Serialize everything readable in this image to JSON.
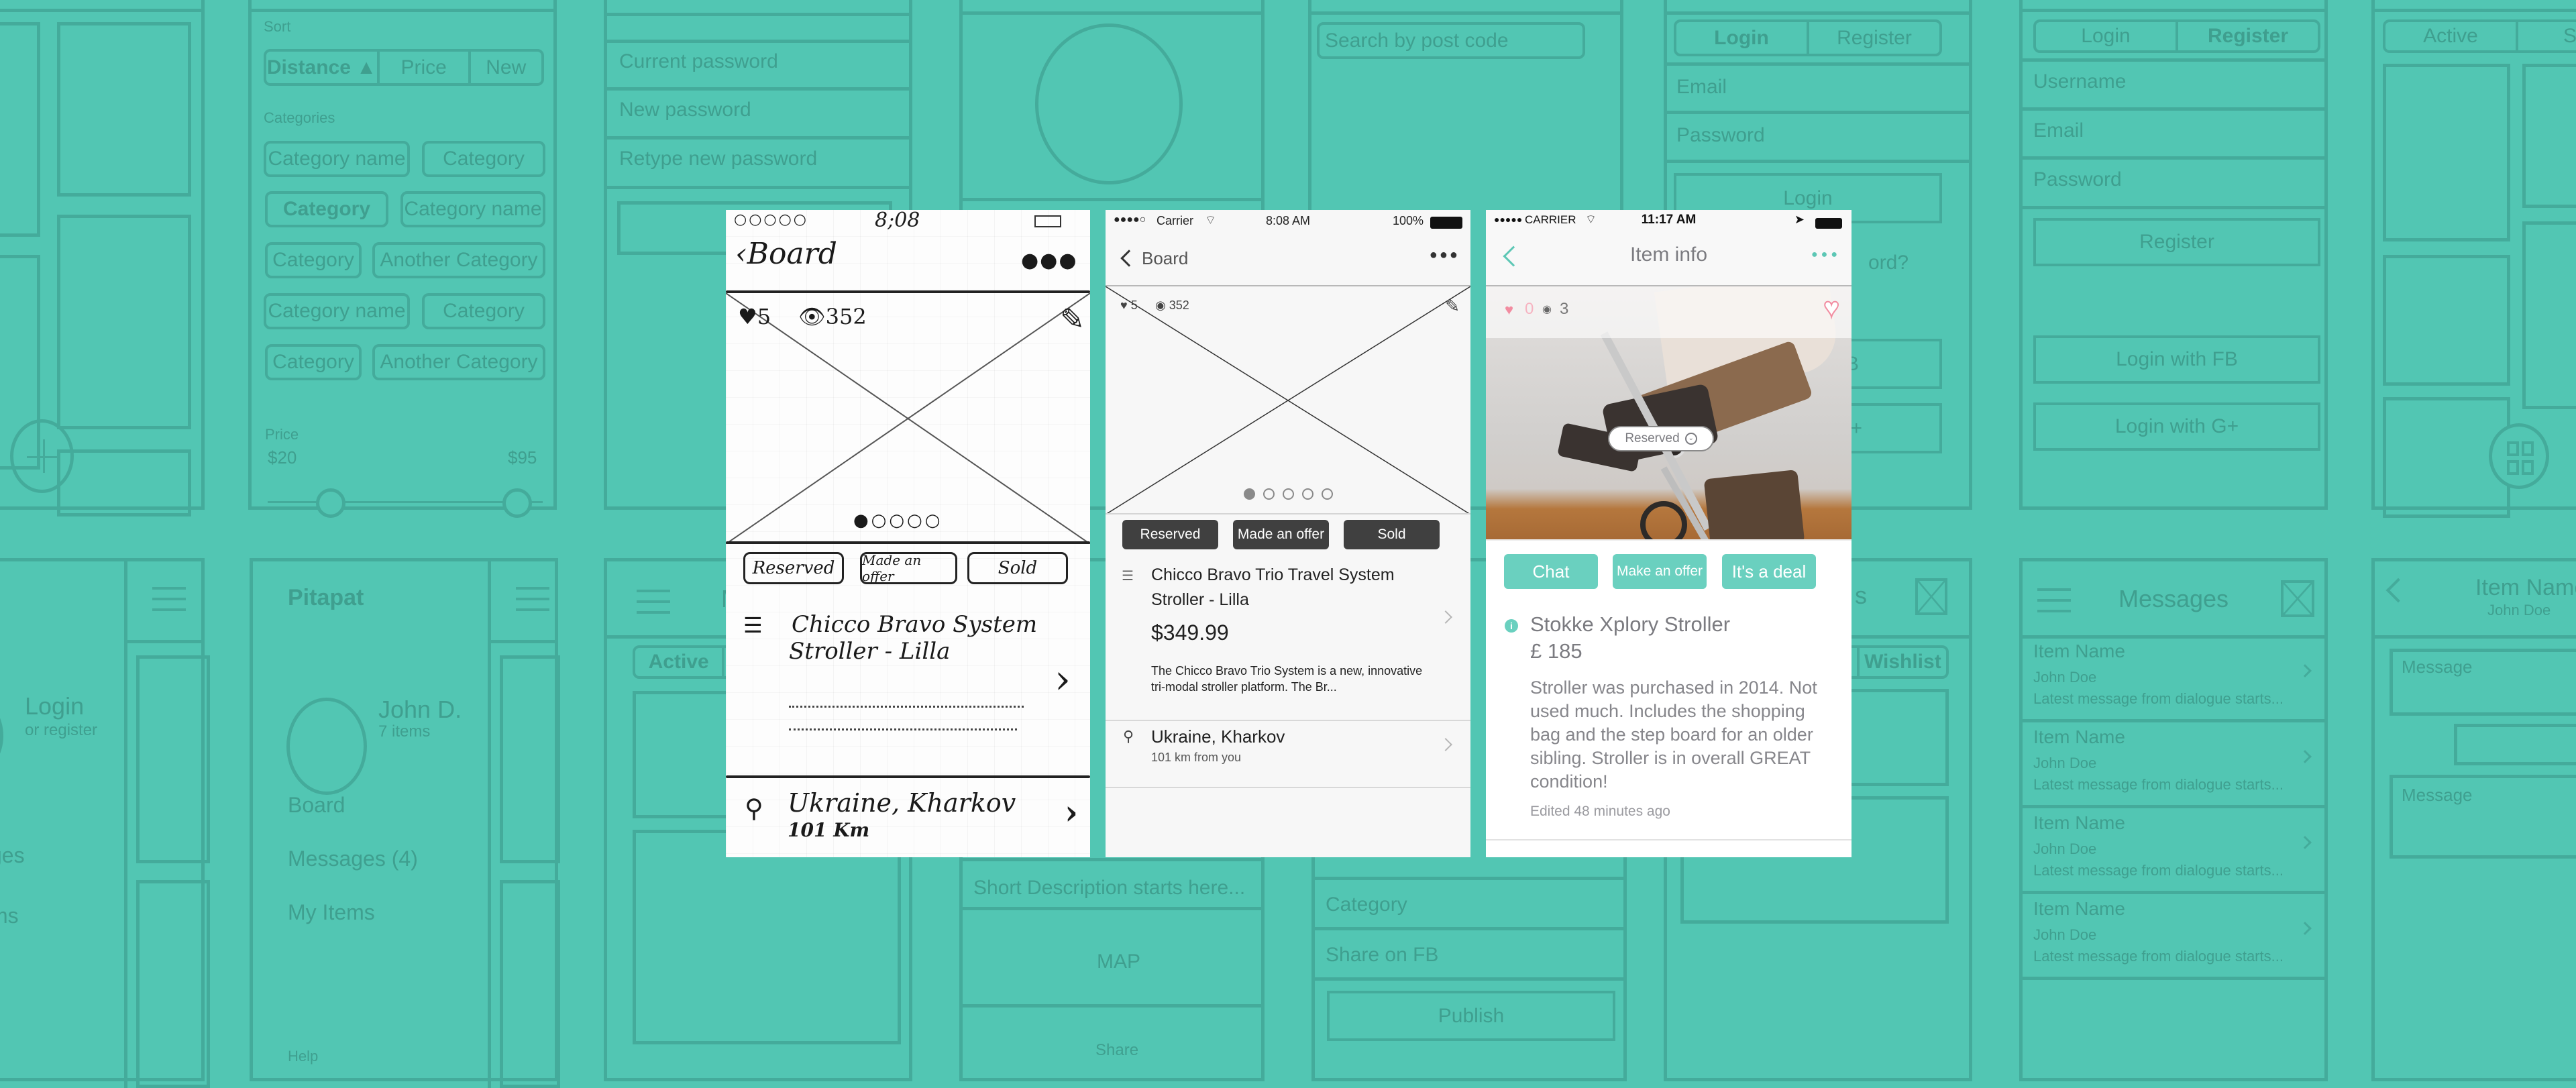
{
  "background": {
    "filter_screen": {
      "sort_label": "Sort",
      "sort_options": [
        "Distance ▲",
        "Price",
        "New"
      ],
      "categories_label": "Categories",
      "category_chips": [
        "Category name",
        "Category",
        "Category",
        "Category name",
        "Category",
        "Another Category",
        "Category name",
        "Category",
        "Category",
        "Another Category"
      ],
      "price_label": "Price",
      "price_min": "$20",
      "price_max": "$95"
    },
    "menu_screen_partial": {
      "title_fragment": "t",
      "login": "Login",
      "or_register": "or register",
      "items": [
        "ges",
        "ms"
      ]
    },
    "menu_screen": {
      "title": "Pitapat",
      "user_name": "John D.",
      "user_items": "7 items",
      "items": [
        "Board",
        "Messages (4)",
        "My Items"
      ],
      "help": "Help"
    },
    "password_screen": {
      "fields": [
        "Current password",
        "New password",
        "Retype new password"
      ]
    },
    "my_items_screen": {
      "title_fragment": "M",
      "tabs": [
        "Active"
      ]
    },
    "item_edit_screen": {
      "short_description": "Short Description starts here...",
      "map": "MAP",
      "share": "Share"
    },
    "search_screen": {
      "search_placeholder": "Search by post code",
      "category": "Category",
      "share_fb": "Share on FB",
      "publish": "Publish"
    },
    "login_screen": {
      "tabs": [
        "Login",
        "Register"
      ],
      "fields": [
        "Email",
        "Password"
      ],
      "login_button": "Login",
      "forgot_fragment": "ord?",
      "fb_fragment": "FB",
      "gplus_fragment": "G+"
    },
    "wishlist_screen": {
      "title_fragment": "s",
      "tab": "Wishlist"
    },
    "register_screen": {
      "tabs": [
        "Login",
        "Register"
      ],
      "fields": [
        "Username",
        "Email",
        "Password"
      ],
      "register_button": "Register",
      "login_fb": "Login with FB",
      "login_gplus": "Login with G+"
    },
    "messages_screen": {
      "title": "Messages",
      "rows": [
        {
          "item": "Item Name",
          "user": "John Doe",
          "preview": "Latest message from dialogue starts..."
        },
        {
          "item": "Item Name",
          "user": "John Doe",
          "preview": "Latest message from dialogue starts..."
        },
        {
          "item": "Item Name",
          "user": "John Doe",
          "preview": "Latest message from dialogue starts..."
        },
        {
          "item": "Item Name",
          "user": "John Doe",
          "preview": "Latest message from dialogue starts..."
        }
      ]
    },
    "status_screen": {
      "tabs": [
        "Active",
        "Sold"
      ]
    },
    "chat_screen": {
      "title": "Item Name",
      "subtitle": "John Doe",
      "message_placeholder_1": "Message",
      "message_placeholder_2": "Message"
    }
  },
  "sketch": {
    "status_time": "8;08",
    "back_label": "Board",
    "likes": "5",
    "views": "352",
    "buttons": [
      "Reserved",
      "Made an offer",
      "Sold"
    ],
    "title_line1": "Chicco Bravo System",
    "title_line2": "Stroller - Lilla",
    "location": "Ukraine, Kharkov",
    "distance": "101 Km"
  },
  "wireframe": {
    "status": {
      "carrier": "Carrier",
      "time": "8:08 AM",
      "battery": "100%"
    },
    "back_label": "Board",
    "likes": "5",
    "views": "352",
    "carousel": {
      "total": 5,
      "active": 1
    },
    "buttons": [
      "Reserved",
      "Made an offer",
      "Sold"
    ],
    "title": "Chicco Bravo Trio Travel System Stroller - Lilla",
    "price": "$349.99",
    "description": "The Chicco Bravo Trio System is a new, innovative tri-modal stroller platform. The Br...",
    "location": "Ukraine, Kharkov",
    "distance": "101 km from you"
  },
  "final": {
    "status": {
      "carrier": "CARRIER",
      "time": "11:17 AM"
    },
    "title": "Item info",
    "likes": "0",
    "views": "3",
    "reserved_badge": "Reserved",
    "buttons": [
      "Chat",
      "Make an offer",
      "It's a deal"
    ],
    "item_name": "Stokke Xplory Stroller",
    "price": "£ 185",
    "description": "Stroller was purchased in 2014. Not used much. Includes the shopping bag and the step board for an older sibling. Stroller is in overall GREAT condition!",
    "edited": "Edited 48 minutes ago",
    "colors": {
      "accent": "#6ad0bf",
      "heart": "#f28ca0",
      "background": "#52c6b3"
    }
  }
}
